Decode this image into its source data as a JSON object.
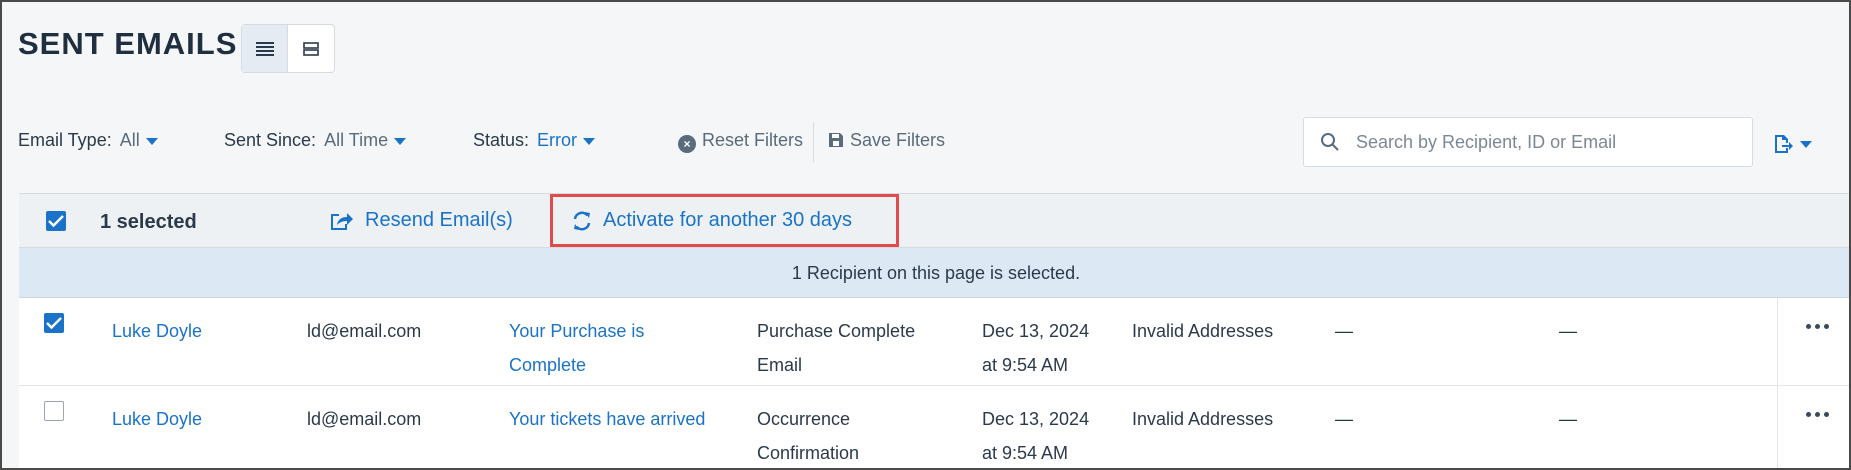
{
  "header": {
    "title": "SENT EMAILS",
    "view_toggle": {
      "list_icon": "list-view-icon",
      "card_icon": "card-view-icon"
    }
  },
  "filters": {
    "email_type": {
      "label": "Email Type:",
      "value": "All"
    },
    "sent_since": {
      "label": "Sent Since:",
      "value": "All Time"
    },
    "status": {
      "label": "Status:",
      "value": "Error"
    },
    "reset_label": "Reset Filters",
    "save_label": "Save Filters"
  },
  "search": {
    "placeholder": "Search by Recipient, ID or Email",
    "value": ""
  },
  "actions": {
    "selected_label": "1 selected",
    "resend_label": "Resend Email(s)",
    "activate_label": "Activate for another 30 days"
  },
  "notice": "1 Recipient on this page is selected.",
  "rows": [
    {
      "selected": true,
      "recipient": "Luke Doyle",
      "email": "ld@email.com",
      "subject_line1": "Your Purchase is",
      "subject_line2": "Complete",
      "type_line1": "Purchase Complete",
      "type_line2": "Email",
      "date_line1": "Dec 13, 2024",
      "date_line2": "at 9:54 AM",
      "error": "Invalid Addresses",
      "col_a": "—",
      "col_b": "—"
    },
    {
      "selected": false,
      "recipient": "Luke Doyle",
      "email": "ld@email.com",
      "subject_line1": "Your tickets have arrived",
      "subject_line2": "",
      "type_line1": "Occurrence",
      "type_line2": "Confirmation",
      "date_line1": "Dec 13, 2024",
      "date_line2": "at 9:54 AM",
      "error": "Invalid Addresses",
      "col_a": "—",
      "col_b": "—"
    }
  ],
  "colors": {
    "accent": "#1a73c8",
    "highlight_border": "#e24b4b",
    "notice_bg": "#dde8f5"
  }
}
